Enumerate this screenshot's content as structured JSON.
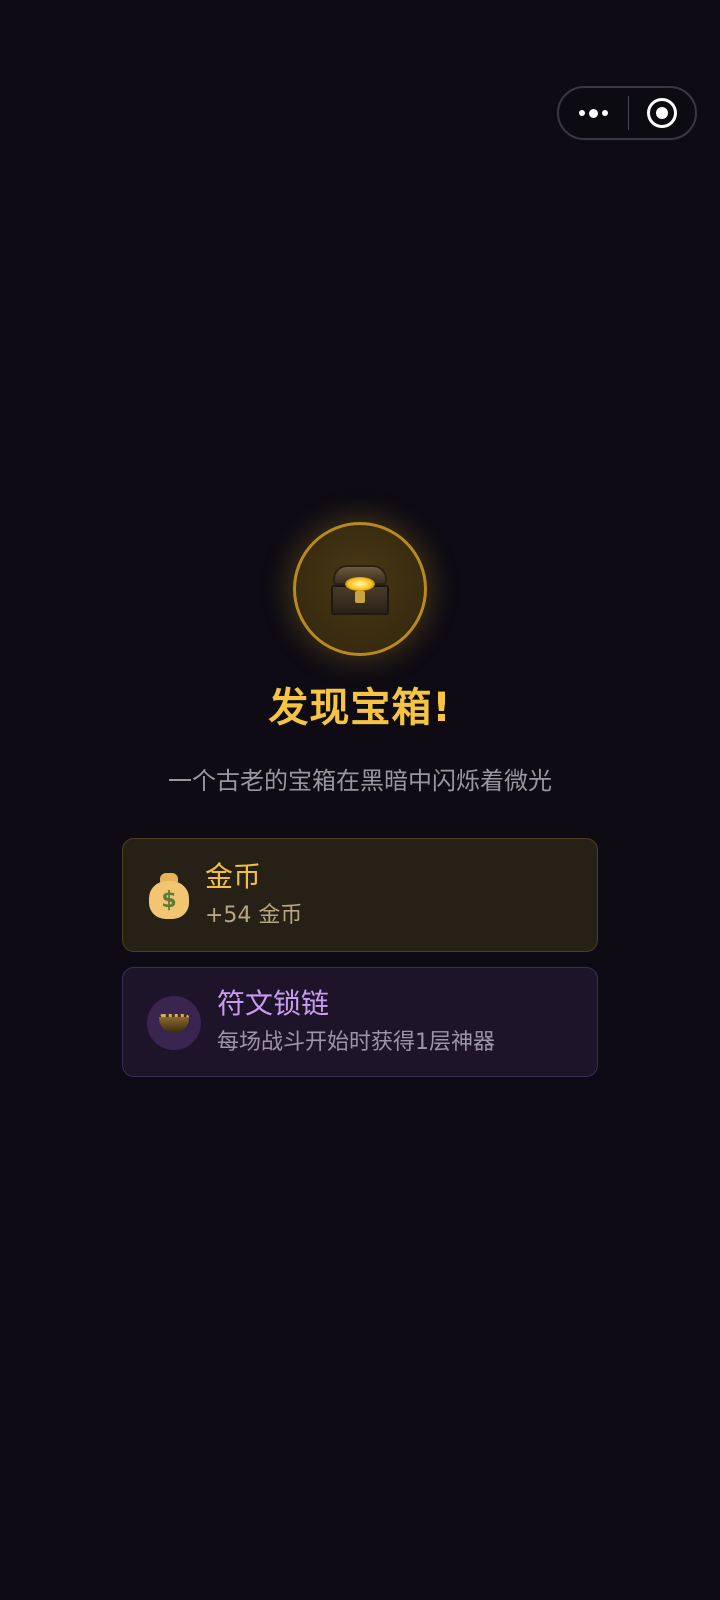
{
  "capsule": {
    "more_icon": "more-dots-icon",
    "close_icon": "target-close-icon"
  },
  "event": {
    "icon": "treasure-chest-icon",
    "title": "发现宝箱!",
    "description": "一个古老的宝箱在黑暗中闪烁着微光"
  },
  "rewards": [
    {
      "icon": "money-bag-icon",
      "name": "金币",
      "detail": "+54 金币",
      "accent": "#f0c040"
    },
    {
      "icon": "rune-chain-icon",
      "name": "符文锁链",
      "detail": "每场战斗开始时获得1层神器",
      "accent": "#c99cf2"
    }
  ]
}
